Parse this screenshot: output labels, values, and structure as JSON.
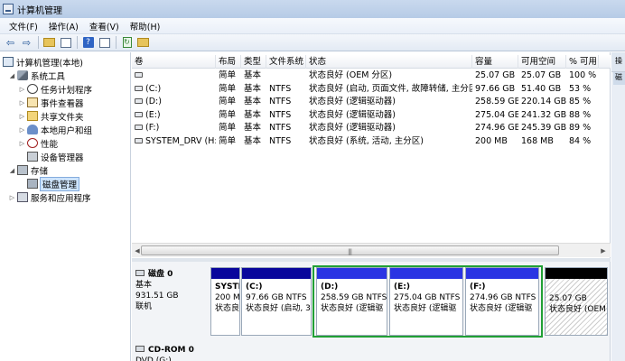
{
  "window": {
    "title": "计算机管理"
  },
  "menu": [
    {
      "label": "文件(F)"
    },
    {
      "label": "操作(A)"
    },
    {
      "label": "查看(V)"
    },
    {
      "label": "帮助(H)"
    }
  ],
  "toolbar": {
    "back_icon": "arrow-left-icon",
    "forward_icon": "arrow-right-icon",
    "help_glyph": "?",
    "refresh_glyph": "↻"
  },
  "tree": {
    "root": "计算机管理(本地)",
    "system_tools": "系统工具",
    "task_scheduler": "任务计划程序",
    "event_viewer": "事件查看器",
    "shared_folders": "共享文件夹",
    "local_users": "本地用户和组",
    "performance": "性能",
    "device_manager": "设备管理器",
    "storage": "存储",
    "disk_management": "磁盘管理",
    "services": "服务和应用程序"
  },
  "volumes": {
    "headers": [
      "卷",
      "布局",
      "类型",
      "文件系统",
      "状态",
      "容量",
      "可用空间",
      "% 可用"
    ],
    "rows": [
      [
        "",
        "简单",
        "基本",
        "",
        "状态良好 (OEM 分区)",
        "25.07 GB",
        "25.07 GB",
        "100 %"
      ],
      [
        "(C:)",
        "简单",
        "基本",
        "NTFS",
        "状态良好 (启动, 页面文件, 故障转储, 主分区)",
        "97.66 GB",
        "51.40 GB",
        "53 %"
      ],
      [
        "(D:)",
        "简单",
        "基本",
        "NTFS",
        "状态良好 (逻辑驱动器)",
        "258.59 GB",
        "220.14 GB",
        "85 %"
      ],
      [
        "(E:)",
        "简单",
        "基本",
        "NTFS",
        "状态良好 (逻辑驱动器)",
        "275.04 GB",
        "241.32 GB",
        "88 %"
      ],
      [
        "(F:)",
        "简单",
        "基本",
        "NTFS",
        "状态良好 (逻辑驱动器)",
        "274.96 GB",
        "245.39 GB",
        "89 %"
      ],
      [
        "SYSTEM_DRV (H:)",
        "简单",
        "基本",
        "NTFS",
        "状态良好 (系统, 活动, 主分区)",
        "200 MB",
        "168 MB",
        "84 %"
      ]
    ]
  },
  "disk0": {
    "name": "磁盘 0",
    "type": "基本",
    "size": "931.51 GB",
    "status": "联机",
    "partitions": [
      {
        "name": "SYSTI",
        "size": "200 M",
        "status": "状态良"
      },
      {
        "name": "(C:)",
        "size": "97.66 GB NTFS",
        "status": "状态良好 (启动, 3"
      },
      {
        "name": "(D:)",
        "size": "258.59 GB NTFS",
        "status": "状态良好 (逻辑驱"
      },
      {
        "name": "(E:)",
        "size": "275.04 GB NTFS",
        "status": "状态良好 (逻辑驱"
      },
      {
        "name": "(F:)",
        "size": "274.96 GB NTFS",
        "status": "状态良好 (逻辑驱"
      },
      {
        "name": "",
        "size": "25.07 GB",
        "status": "状态良好 (OEM"
      }
    ]
  },
  "cdrom": {
    "name": "CD-ROM 0",
    "type": "DVD (G:)"
  },
  "actions": {
    "header": "操",
    "item": "磁"
  },
  "colors": {
    "primary_partition": "#09069c",
    "logical_drive": "#2a34e3",
    "extended_partition": "#21a035",
    "selection": "#cde3fb"
  }
}
